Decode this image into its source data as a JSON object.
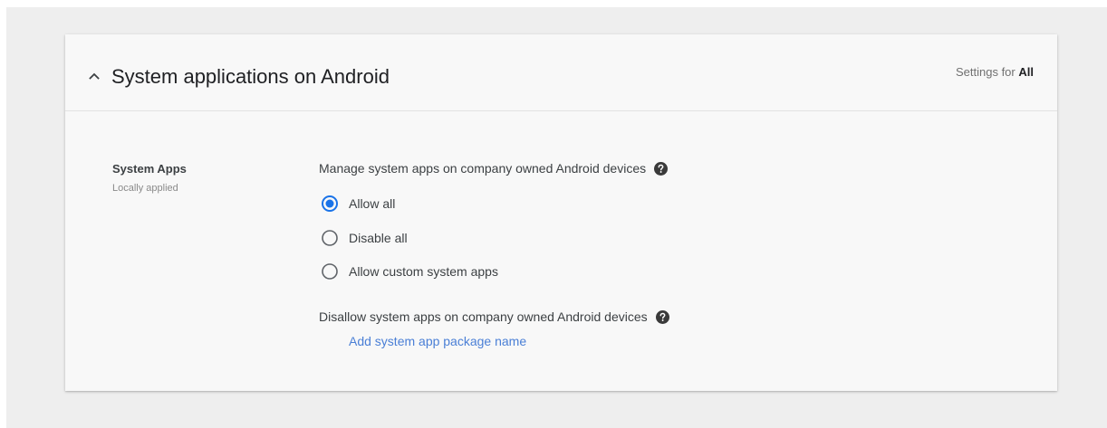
{
  "section": {
    "title": "System applications on Android",
    "collapse_icon": "chevron-up-icon",
    "settings_for_prefix": "Settings for",
    "settings_for_scope": "All"
  },
  "setting": {
    "name": "System Apps",
    "status": "Locally applied"
  },
  "manage": {
    "label": "Manage system apps on company owned Android devices",
    "help_icon": "help-circle-icon",
    "options": [
      {
        "label": "Allow all",
        "selected": true
      },
      {
        "label": "Disable all",
        "selected": false
      },
      {
        "label": "Allow custom system apps",
        "selected": false
      }
    ]
  },
  "disallow": {
    "label": "Disallow system apps on company owned Android devices",
    "help_icon": "help-circle-icon",
    "add_link": "Add system app package name"
  },
  "colors": {
    "accent": "#1a73e8",
    "link": "#4a7fd6",
    "page_bg": "#eeeeee",
    "card_bg": "#f8f8f8"
  }
}
